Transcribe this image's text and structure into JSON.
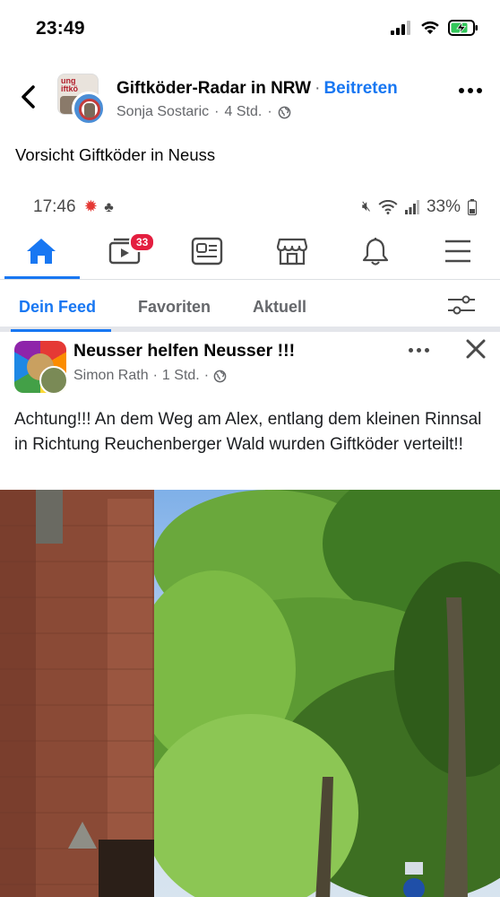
{
  "status_bar": {
    "time": "23:49"
  },
  "group": {
    "name": "Giftköder-Radar in NRW",
    "separator": "·",
    "join_label": "Beitreten",
    "author": "Sonja Sostaric",
    "time_ago": "4 Std.",
    "avatar_text": "Achtung Giftköder"
  },
  "post": {
    "text": "Vorsicht Giftköder in Neuss"
  },
  "embedded_screenshot": {
    "status": {
      "time": "17:46",
      "battery": "33%"
    },
    "nav": {
      "items": [
        "home-icon",
        "watch-icon",
        "news-icon",
        "marketplace-icon",
        "bell-icon",
        "menu-icon"
      ],
      "watch_badge": "33"
    },
    "feed_tabs": [
      "Dein Feed",
      "Favoriten",
      "Aktuell"
    ],
    "post": {
      "group_name": "Neusser helfen Neusser !!!",
      "author": "Simon Rath",
      "time_ago": "1 Std.",
      "text": "Achtung!!! An dem Weg am Alex, entlang dem kleinen Rinnsal in Richtung Reuchenberger Wald wurden Giftköder verteilt!!"
    }
  },
  "colors": {
    "accent": "#1877f2",
    "text": "#050505",
    "secondary_text": "#65676b",
    "badge": "#e41e3f"
  }
}
